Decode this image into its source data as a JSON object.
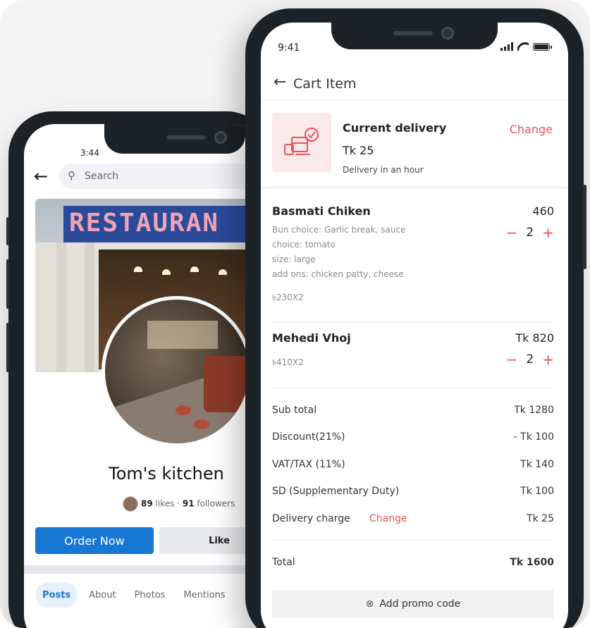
{
  "back_phone": {
    "time": "3:44",
    "search_placeholder": "Search",
    "cover_sign": "RESTAURAN",
    "page_name": "Tom's kitchen",
    "stats": {
      "likes_count": "89",
      "likes_label": "likes",
      "separator": "·",
      "followers_count": "91",
      "followers_label": "followers"
    },
    "buttons": {
      "order_now": "Order Now",
      "like": "Like"
    },
    "tabs": [
      {
        "label": "Posts",
        "active": true
      },
      {
        "label": "About",
        "active": false
      },
      {
        "label": "Photos",
        "active": false
      },
      {
        "label": "Mentions",
        "active": false
      }
    ]
  },
  "front_phone": {
    "time": "9:41",
    "header": {
      "title": "Cart Item"
    },
    "delivery": {
      "title": "Current delivery",
      "price": "Tk 25",
      "note": "Delivery in an hour",
      "change_label": "Change"
    },
    "items": [
      {
        "name": "Basmati Chiken",
        "price": "460",
        "details": [
          "Bun choice: Garlic break, sauce",
          "choice: tomato",
          "size: large",
          "add ons: chicken patty, cheese"
        ],
        "unit": "৳230X2",
        "qty": "2"
      },
      {
        "name": "Mehedi Vhoj",
        "price": "Tk 820",
        "details": [],
        "unit": "৳410X2",
        "qty": "2"
      }
    ],
    "summary": {
      "subtotal": {
        "label": "Sub total",
        "value": "Tk 1280"
      },
      "discount": {
        "label": "Discount(21%)",
        "value": "- Tk 100"
      },
      "vat": {
        "label": "VAT/TAX (11%)",
        "value": "Tk 140"
      },
      "sd": {
        "label": "SD (Supplementary Duty)",
        "value": "Tk 100"
      },
      "delivery": {
        "label": "Delivery charge",
        "change_label": "Change",
        "value": "Tk 25"
      },
      "total": {
        "label": "Total",
        "value": "Tk 1600"
      }
    },
    "promo": {
      "label": "Add promo code"
    }
  },
  "colors": {
    "accent_red": "#e2545a",
    "facebook_blue": "#1877d2",
    "dark_frame": "#1c2226"
  }
}
